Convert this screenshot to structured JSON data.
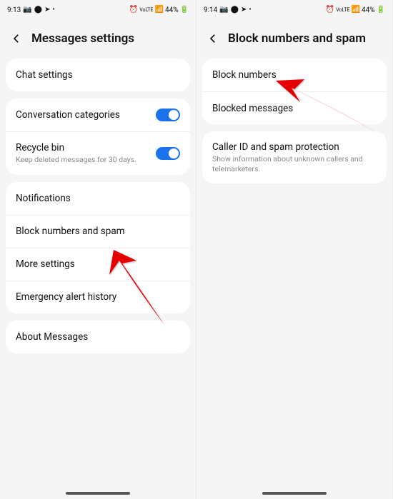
{
  "left": {
    "status": {
      "time": "9:13",
      "battery": "44%"
    },
    "title": "Messages settings",
    "card1": {
      "chat": "Chat settings"
    },
    "card2": {
      "conv": "Conversation categories",
      "recycle": "Recycle bin",
      "recycle_sub": "Keep deleted messages for 30 days."
    },
    "card3": {
      "notif": "Notifications",
      "block": "Block numbers and spam",
      "more": "More settings",
      "emergency": "Emergency alert history"
    },
    "card4": {
      "about": "About Messages"
    }
  },
  "right": {
    "status": {
      "time": "9:14",
      "battery": "44%"
    },
    "title": "Block numbers and spam",
    "card1": {
      "blocknum": "Block numbers",
      "blockedmsg": "Blocked messages"
    },
    "card2": {
      "caller": "Caller ID and spam protection",
      "caller_sub": "Show information about unknown callers and telemarketers."
    }
  }
}
